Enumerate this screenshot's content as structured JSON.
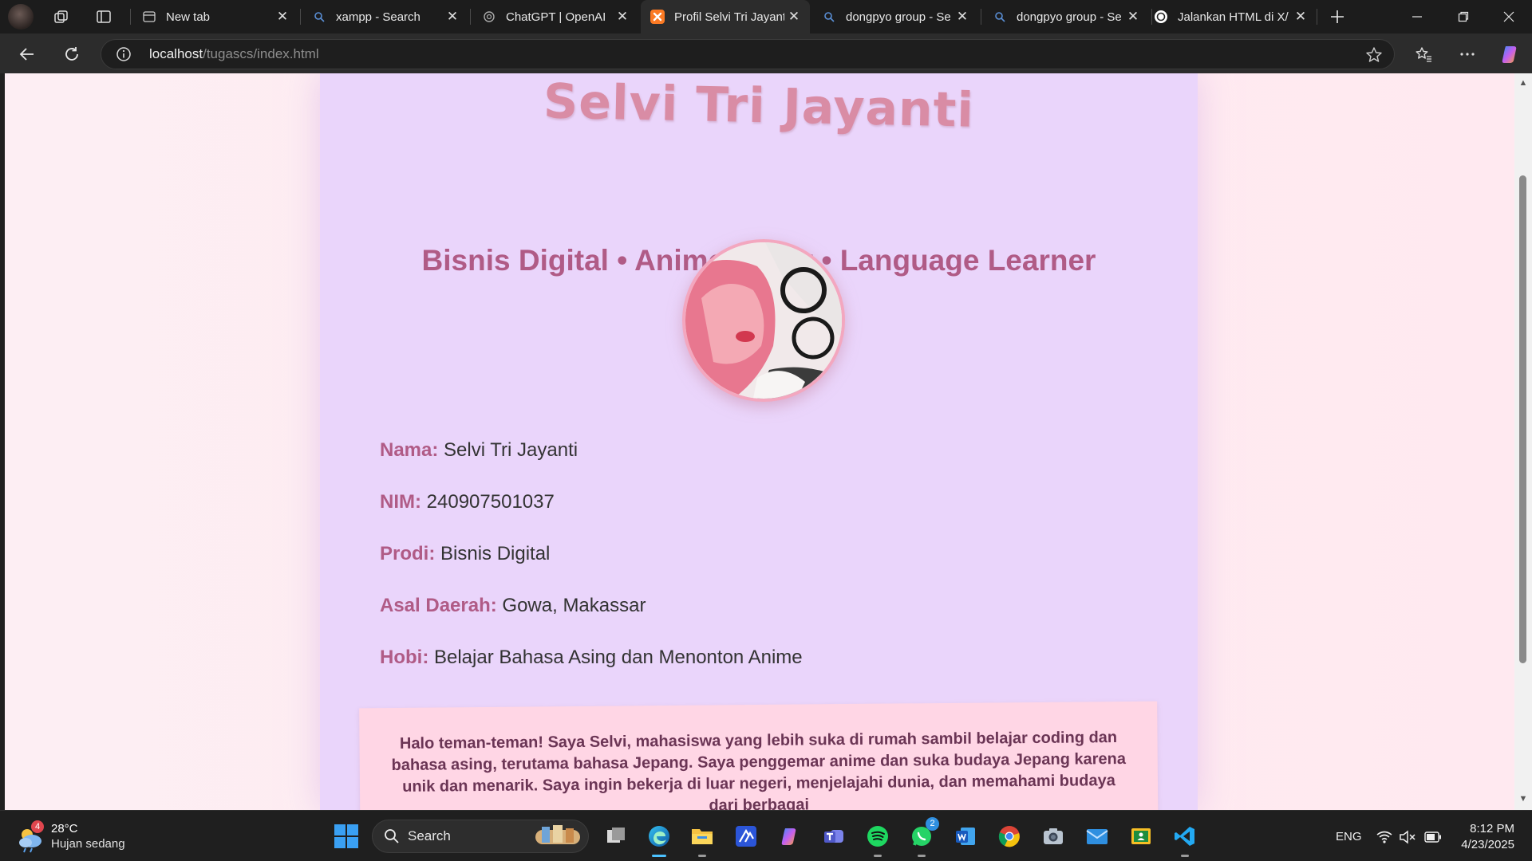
{
  "browser": {
    "tabs": [
      {
        "title": "New tab",
        "favicon": "newtab-icon",
        "active": false
      },
      {
        "title": "xampp - Search",
        "favicon": "search-icon",
        "active": false
      },
      {
        "title": "ChatGPT | OpenAI",
        "favicon": "openai-icon",
        "active": false
      },
      {
        "title": "Profil Selvi Tri Jayanti",
        "favicon": "xampp-icon",
        "active": true
      },
      {
        "title": "dongpyo group - Se",
        "favicon": "search-icon",
        "active": false
      },
      {
        "title": "dongpyo group - Se",
        "favicon": "search-icon",
        "active": false
      },
      {
        "title": "Jalankan HTML di X/",
        "favicon": "chatgpt-icon",
        "active": false
      }
    ],
    "url_host": "localhost",
    "url_path": "/tugascs/index.html"
  },
  "page": {
    "name": "Selvi Tri Jayanti",
    "tagline": "Bisnis Digital • Anime Lover • Language Learner",
    "info": [
      {
        "label": "Nama:",
        "value": "Selvi Tri Jayanti"
      },
      {
        "label": "NIM:",
        "value": "240907501037"
      },
      {
        "label": "Prodi:",
        "value": "Bisnis Digital"
      },
      {
        "label": "Asal Daerah:",
        "value": "Gowa, Makassar"
      },
      {
        "label": "Hobi:",
        "value": "Belajar Bahasa Asing dan Menonton Anime"
      }
    ],
    "about": "Halo teman-teman! Saya Selvi, mahasiswa yang lebih suka di rumah sambil belajar coding dan bahasa asing, terutama bahasa Jepang. Saya penggemar anime dan suka budaya Jepang karena unik dan menarik. Saya ingin bekerja di luar negeri, menjelajahi dunia, dan memahami budaya dari berbagai"
  },
  "taskbar": {
    "weather_temp": "28°C",
    "weather_desc": "Hujan sedang",
    "weather_badge": "4",
    "search_label": "Search",
    "whatsapp_badge": "2",
    "language": "ENG",
    "time": "8:12 PM",
    "date": "4/23/2025"
  },
  "colors": {
    "accent_pink": "#d98ca5",
    "label_mauve": "#b05b86",
    "card_lavender": "#ead5fb",
    "about_pink": "#ffd6e5"
  }
}
